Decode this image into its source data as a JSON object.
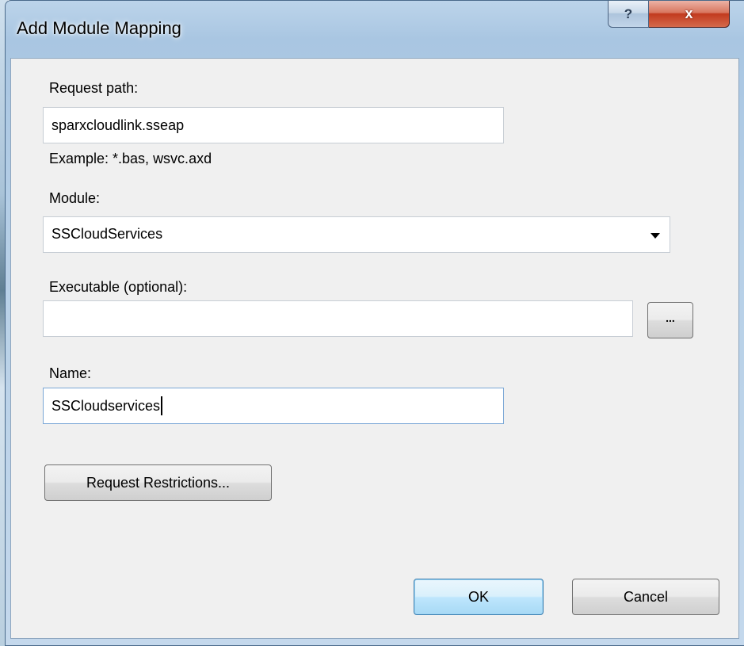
{
  "window": {
    "title": "Add Module Mapping",
    "help_label": "?",
    "close_label": "x"
  },
  "request_path": {
    "label": "Request path:",
    "value": "sparxcloudlink.sseap",
    "example": "Example: *.bas, wsvc.axd"
  },
  "module": {
    "label": "Module:",
    "selected": "SSCloudServices"
  },
  "executable": {
    "label": "Executable (optional):",
    "value": "",
    "browse_label": "..."
  },
  "name": {
    "label": "Name:",
    "value": "SSCloudservices"
  },
  "buttons": {
    "request_restrictions": "Request Restrictions...",
    "ok": "OK",
    "cancel": "Cancel"
  }
}
